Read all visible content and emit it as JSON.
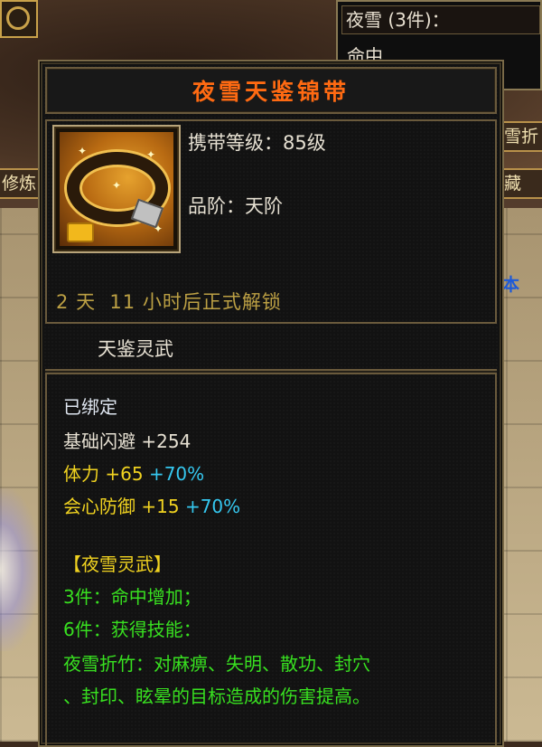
{
  "background": {
    "left_tab": "修炼",
    "right_tab_1": "雪折",
    "right_tab_2": "藏",
    "right_blue_text": "本",
    "set_tooltip": {
      "title": "夜雪 (3件)：",
      "row": "命中"
    }
  },
  "item": {
    "name": "夜雪天鉴锦带",
    "level_label": "携带等级：",
    "level_value": "85级",
    "grade_label": "品阶：",
    "grade_value": "天阶",
    "unlock_days": "2",
    "unlock_days_unit": "天",
    "unlock_hours": "11",
    "unlock_hours_unit": "小时后正式解锁",
    "series_name": "天鉴灵武",
    "icon": "belt-icon"
  },
  "attributes": {
    "bound": "已绑定",
    "stats": [
      {
        "name": "基础闪避",
        "value": "+254",
        "bonus": ""
      },
      {
        "name": "体力",
        "value": "+65",
        "bonus": "+70%"
      },
      {
        "name": "会心防御",
        "value": "+15",
        "bonus": "+70%"
      }
    ]
  },
  "set_bonus": {
    "title": "【夜雪灵武】",
    "three_piece": "3件：命中增加；",
    "six_piece": "6件：获得技能：",
    "skill_line_1": "夜雪折竹：对麻痹、失明、散功、封穴",
    "skill_line_2": "、封印、眩晕的目标造成的伤害提高。"
  },
  "colors": {
    "item_name": "#ff6a12",
    "unlock": "#bca044",
    "stat_yellow": "#f0d220",
    "bonus_cyan": "#35c8f0",
    "set_green": "#38e020"
  }
}
